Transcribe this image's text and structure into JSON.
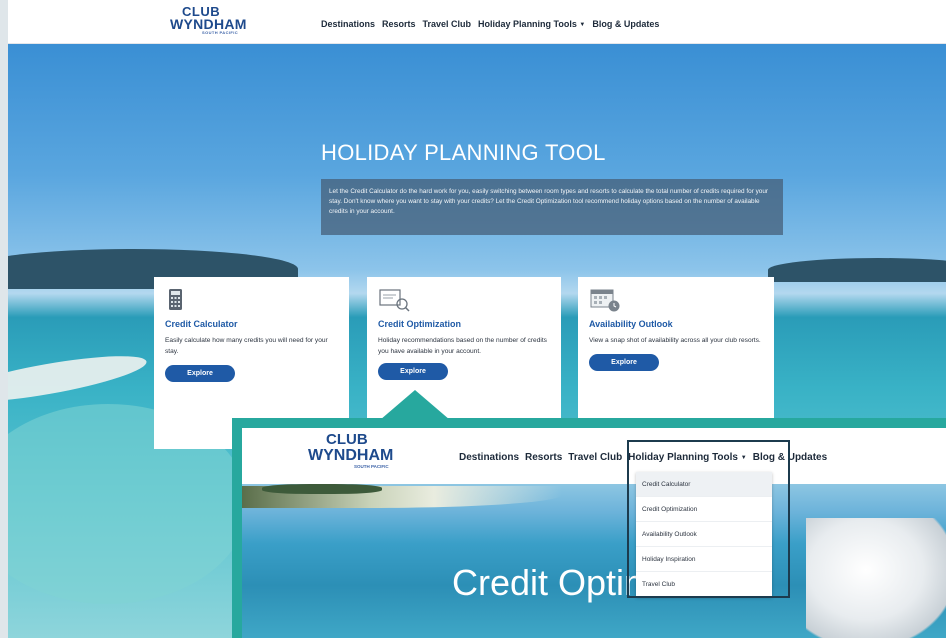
{
  "header": {
    "logo": {
      "line1": "CLUB",
      "line2": "WYNDHAM",
      "line3": "SOUTH PACIFIC"
    },
    "nav": [
      "Destinations",
      "Resorts",
      "Travel Club",
      "Holiday Planning Tools",
      "Blog & Updates"
    ]
  },
  "hero": {
    "title": "HOLIDAY PLANNING TOOL",
    "intro": "Let the Credit Calculator do the hard work for you, easily switching between room types and resorts to calculate the total number of credits required for your stay. Don't know where you want to stay with your credits? Let the Credit Optimization tool recommend holiday options based on the number of available credits in your account."
  },
  "cards": [
    {
      "icon": "calculator-icon",
      "title": "Credit Calculator",
      "text": "Easily calculate how many credits you will need for your stay.",
      "button": "Explore"
    },
    {
      "icon": "optimization-icon",
      "title": "Credit Optimization",
      "text": "Holiday recommendations based on the number of credits you have available in your account.",
      "button": "Explore"
    },
    {
      "icon": "availability-icon",
      "title": "Availability Outlook",
      "text": "View a snap shot of availability across all your club resorts.",
      "button": "Explore"
    }
  ],
  "inset": {
    "logo": {
      "line1": "CLUB",
      "line2": "WYNDHAM",
      "line3": "SOUTH PACIFIC"
    },
    "nav": [
      "Destinations",
      "Resorts",
      "Travel Club",
      "Holiday Planning Tools",
      "Blog & Updates"
    ],
    "dropdown": [
      "Credit Calculator",
      "Credit Optimization",
      "Availability Outlook",
      "Holiday Inspiration",
      "Travel Club"
    ],
    "page_title": "Credit Optimization",
    "accent": "#27a89e"
  }
}
